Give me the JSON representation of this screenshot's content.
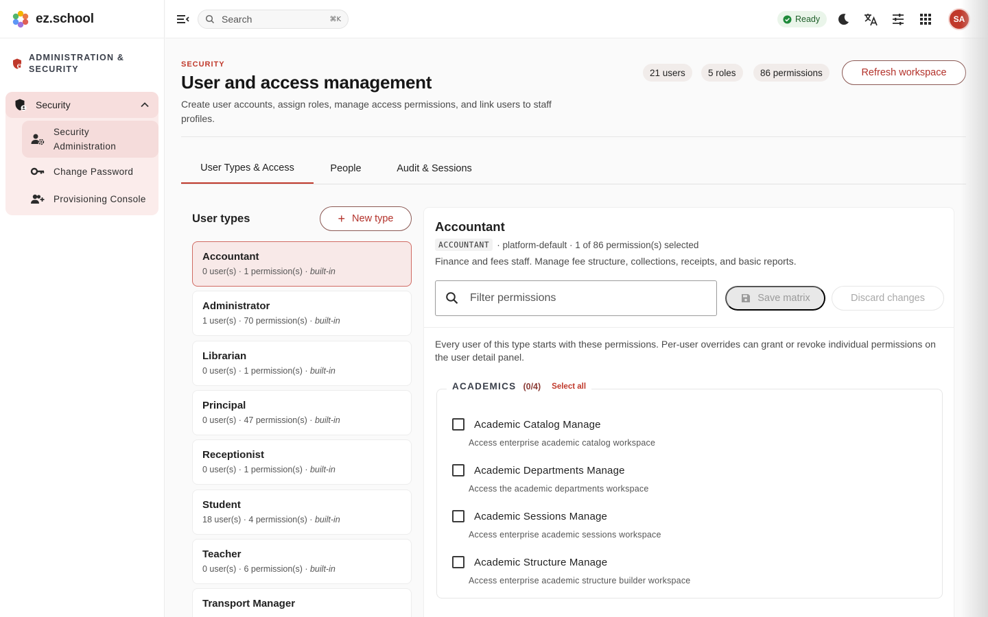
{
  "brand": {
    "name": "ez.school"
  },
  "sidebar": {
    "section_title": "ADMINISTRATION & SECURITY",
    "group_label": "Security",
    "items": [
      {
        "label": "Security Administration"
      },
      {
        "label": "Change Password"
      },
      {
        "label": "Provisioning Console"
      }
    ]
  },
  "topbar": {
    "search_placeholder": "Search",
    "search_shortcut": "⌘K",
    "status": "Ready",
    "avatar_initials": "SA",
    "icons": [
      "moon-icon",
      "translate-icon",
      "tune-icon",
      "apps-grid-icon"
    ]
  },
  "header": {
    "eyebrow": "SECURITY",
    "title": "User and access management",
    "subtitle": "Create user accounts, assign roles, manage access permissions, and link users to staff profiles.",
    "chips": {
      "users": "21 users",
      "roles": "5 roles",
      "permissions": "86 permissions"
    },
    "refresh_label": "Refresh workspace"
  },
  "tabs": [
    "User Types & Access",
    "People",
    "Audit & Sessions"
  ],
  "user_types": {
    "title": "User types",
    "new_label": "New type",
    "items": [
      {
        "name": "Accountant",
        "users": "0 user(s)",
        "perms": "1 permission(s)",
        "tag": "built-in"
      },
      {
        "name": "Administrator",
        "users": "1 user(s)",
        "perms": "70 permission(s)",
        "tag": "built-in"
      },
      {
        "name": "Librarian",
        "users": "0 user(s)",
        "perms": "1 permission(s)",
        "tag": "built-in"
      },
      {
        "name": "Principal",
        "users": "0 user(s)",
        "perms": "47 permission(s)",
        "tag": "built-in"
      },
      {
        "name": "Receptionist",
        "users": "0 user(s)",
        "perms": "1 permission(s)",
        "tag": "built-in"
      },
      {
        "name": "Student",
        "users": "18 user(s)",
        "perms": "4 permission(s)",
        "tag": "built-in"
      },
      {
        "name": "Teacher",
        "users": "0 user(s)",
        "perms": "6 permission(s)",
        "tag": "built-in"
      },
      {
        "name": "Transport Manager",
        "users": "",
        "perms": "",
        "tag": ""
      }
    ]
  },
  "detail": {
    "title": "Accountant",
    "code": "ACCOUNTANT",
    "meta": "· platform-default · 1 of 86 permission(s) selected",
    "description": "Finance and fees staff. Manage fee structure, collections, receipts, and basic reports.",
    "filter_placeholder": "Filter permissions",
    "save_label": "Save matrix",
    "discard_label": "Discard changes",
    "note": "Every user of this type starts with these permissions. Per-user overrides can grant or revoke individual permissions on the user detail panel.",
    "group": {
      "title": "ACADEMICS",
      "count": "(0/4)",
      "select_all": "Select all",
      "permissions": [
        {
          "name": "Academic Catalog Manage",
          "desc": "Access enterprise academic catalog workspace",
          "checked": false
        },
        {
          "name": "Academic Departments Manage",
          "desc": "Access the academic departments workspace",
          "checked": false
        },
        {
          "name": "Academic Sessions Manage",
          "desc": "Access enterprise academic sessions workspace",
          "checked": false
        },
        {
          "name": "Academic Structure Manage",
          "desc": "Access enterprise academic structure builder workspace",
          "checked": false
        }
      ]
    }
  },
  "colors": {
    "accent": "#c0392b",
    "accent_soft": "#fbeceb",
    "ready_green": "#1f8a3a"
  }
}
